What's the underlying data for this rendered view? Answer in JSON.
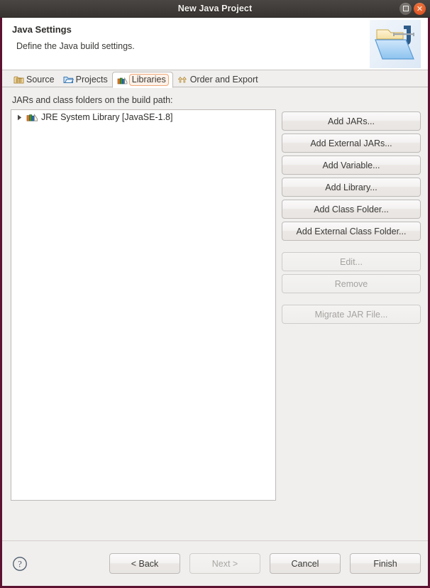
{
  "window": {
    "title": "New Java Project",
    "controls": [
      {
        "name": "maximize",
        "label": "Maximize"
      },
      {
        "name": "close",
        "label": "Close"
      }
    ]
  },
  "header": {
    "title": "Java Settings",
    "subtitle": "Define the Java build settings.",
    "icon": "java-project-folder-icon"
  },
  "tabs": [
    {
      "label": "Source",
      "icon": "source-folder-icon",
      "selected": false
    },
    {
      "label": "Projects",
      "icon": "projects-folder-icon",
      "selected": false
    },
    {
      "label": "Libraries",
      "icon": "libraries-books-icon",
      "selected": true
    },
    {
      "label": "Order and Export",
      "icon": "order-export-arrows-icon",
      "selected": false
    }
  ],
  "main": {
    "list_label": "JARs and class folders on the build path:",
    "tree": {
      "items": [
        {
          "label": "JRE System Library [JavaSE-1.8]",
          "icon": "library-books-icon",
          "expanded": false,
          "twisty": "collapsed-triangle-icon"
        }
      ]
    },
    "buttons": [
      {
        "label": "Add JARs...",
        "name": "add-jars-button",
        "enabled": true
      },
      {
        "label": "Add External JARs...",
        "name": "add-external-jars-button",
        "enabled": true
      },
      {
        "label": "Add Variable...",
        "name": "add-variable-button",
        "enabled": true
      },
      {
        "label": "Add Library...",
        "name": "add-library-button",
        "enabled": true
      },
      {
        "label": "Add Class Folder...",
        "name": "add-class-folder-button",
        "enabled": true
      },
      {
        "label": "Add External Class Folder...",
        "name": "add-external-class-folder-button",
        "enabled": true
      },
      {
        "label": "Edit...",
        "name": "edit-button",
        "enabled": false
      },
      {
        "label": "Remove",
        "name": "remove-button",
        "enabled": false
      },
      {
        "label": "Migrate JAR File...",
        "name": "migrate-jar-file-button",
        "enabled": false
      }
    ]
  },
  "footer": {
    "help_icon": "help-question-icon",
    "buttons": [
      {
        "label": "< Back",
        "name": "back-button",
        "enabled": true
      },
      {
        "label": "Next >",
        "name": "next-button",
        "enabled": false
      },
      {
        "label": "Cancel",
        "name": "cancel-button",
        "enabled": true
      },
      {
        "label": "Finish",
        "name": "finish-button",
        "enabled": true
      }
    ]
  },
  "colors": {
    "window_frame": "#5c1230",
    "titlebar": "#413d3a",
    "close_button": "#d8471d",
    "background": "#f0efee",
    "panel": "#ffffff",
    "tab_focus_ring": "#f0a878",
    "text": "#3a3936",
    "disabled_text": "#a5a29f"
  }
}
